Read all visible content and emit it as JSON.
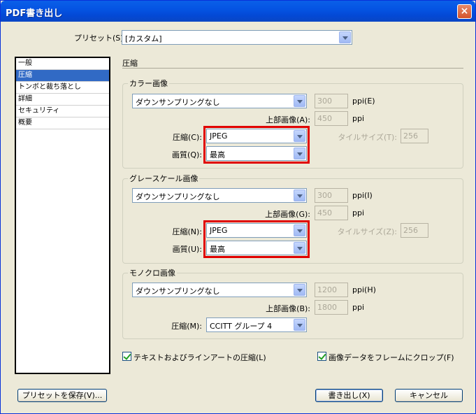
{
  "window": {
    "title": "PDF書き出し",
    "close_label": "×"
  },
  "preset": {
    "label": "プリセット(S):",
    "value": "[カスタム]"
  },
  "sidebar": {
    "items": [
      {
        "label": "一般"
      },
      {
        "label": "圧縮"
      },
      {
        "label": "トンボと裁ち落とし"
      },
      {
        "label": "詳細"
      },
      {
        "label": "セキュリティ"
      },
      {
        "label": "概要"
      }
    ],
    "selected_index": 1
  },
  "section": {
    "title": "圧縮"
  },
  "color_image": {
    "title": "カラー画像",
    "downsample": "ダウンサンプリングなし",
    "ppi_value": "300",
    "ppi_label": "ppi(E)",
    "above_label": "上部画像(A):",
    "above_value": "450",
    "above_unit": "ppi",
    "compression_label": "圧縮(C):",
    "compression_value": "JPEG",
    "quality_label": "画質(Q):",
    "quality_value": "最高",
    "tile_label": "タイルサイズ(T):",
    "tile_value": "256"
  },
  "gray_image": {
    "title": "グレースケール画像",
    "downsample": "ダウンサンプリングなし",
    "ppi_value": "300",
    "ppi_label": "ppi(I)",
    "above_label": "上部画像(G):",
    "above_value": "450",
    "above_unit": "ppi",
    "compression_label": "圧縮(N):",
    "compression_value": "JPEG",
    "quality_label": "画質(U):",
    "quality_value": "最高",
    "tile_label": "タイルサイズ(Z):",
    "tile_value": "256"
  },
  "mono_image": {
    "title": "モノクロ画像",
    "downsample": "ダウンサンプリングなし",
    "ppi_value": "1200",
    "ppi_label": "ppi(H)",
    "above_label": "上部画像(B):",
    "above_value": "1800",
    "above_unit": "ppi",
    "compression_label": "圧縮(M):",
    "compression_value": "CCITT グループ 4"
  },
  "options": {
    "text_lineart": "テキストおよびラインアートの圧縮(L)",
    "crop_frame": "画像データをフレームにクロップ(F)"
  },
  "buttons": {
    "save_preset": "プリセットを保存(V)...",
    "export": "書き出し(X)",
    "cancel": "キャンセル"
  },
  "colors": {
    "title_bar": "#0554e3",
    "highlight": "#e00000",
    "selection": "#316ac5"
  }
}
